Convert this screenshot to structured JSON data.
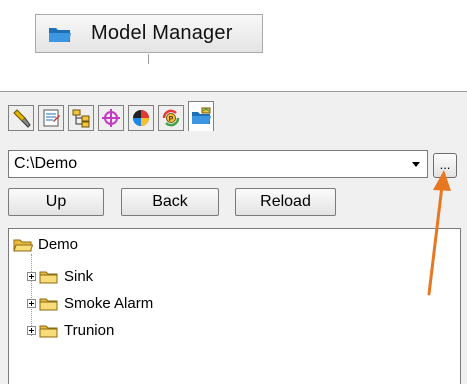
{
  "header": {
    "title": "Model Manager",
    "icon": "folder-icon"
  },
  "toolbar": {
    "tools": [
      {
        "name": "wrench-tool-icon",
        "active": false
      },
      {
        "name": "properties-icon",
        "active": false
      },
      {
        "name": "hierarchy-icon",
        "active": false
      },
      {
        "name": "target-icon",
        "active": false
      },
      {
        "name": "color-wheel-icon",
        "active": false
      },
      {
        "name": "refresh-parameters-icon",
        "active": false
      },
      {
        "name": "model-manager-icon",
        "active": true
      }
    ]
  },
  "path": {
    "value": "C:\\Demo",
    "browse_label": "..."
  },
  "nav": {
    "up": "Up",
    "back": "Back",
    "reload": "Reload"
  },
  "tree": {
    "root": "Demo",
    "items": [
      "Sink",
      "Smoke Alarm",
      "Trunion"
    ]
  },
  "colors": {
    "annotation_arrow": "#e87722",
    "folder": "#f5c542"
  }
}
